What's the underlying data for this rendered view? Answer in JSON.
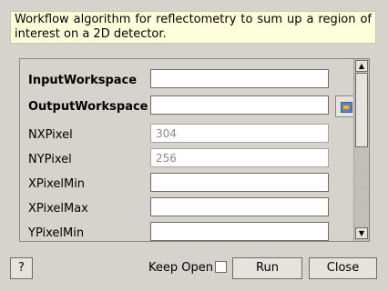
{
  "description": "Workflow algorithm for reflectometry to sum up a region of interest on a 2D detector.",
  "properties": [
    {
      "label": "InputWorkspace",
      "value": "",
      "bold": true
    },
    {
      "label": "OutputWorkspace",
      "value": "",
      "bold": true
    },
    {
      "label": "NXPixel",
      "value": "304",
      "bold": false
    },
    {
      "label": "NYPixel",
      "value": "256",
      "bold": false
    },
    {
      "label": "XPixelMin",
      "value": "",
      "bold": false
    },
    {
      "label": "XPixelMax",
      "value": "",
      "bold": false
    },
    {
      "label": "YPixelMin",
      "value": "",
      "bold": false
    }
  ],
  "buttons": {
    "help": "?",
    "keep_open": "Keep Open",
    "keep_open_checked": false,
    "run": "Run",
    "close": "Close"
  },
  "icons": {
    "browse": "folder-browse-icon",
    "scroll_up": "arrow-up-icon",
    "scroll_down": "arrow-down-icon"
  }
}
